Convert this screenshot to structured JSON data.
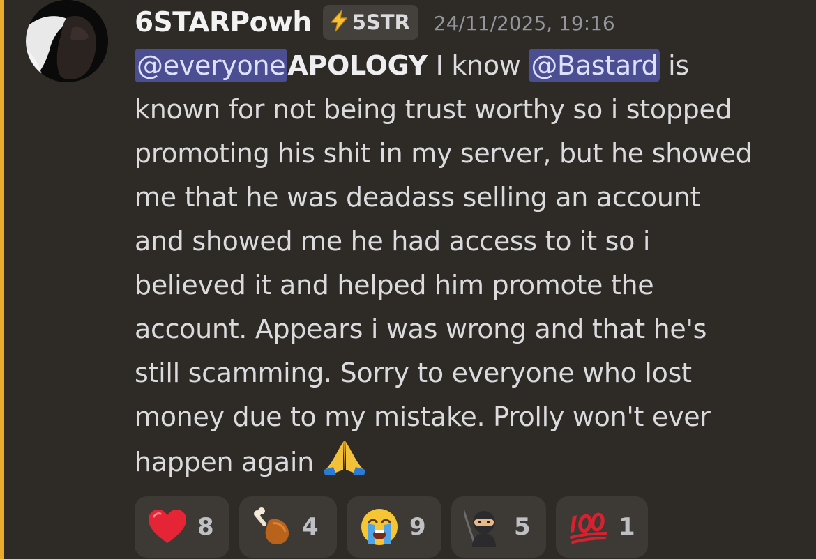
{
  "theme": {
    "background": "#2e2b27",
    "mention_highlight_bar": "#e8ab2e",
    "mention_pill": "#4b4f92",
    "text": "#dbdbde"
  },
  "message": {
    "author": {
      "username": "6STARPowh",
      "avatar_icon": "user-avatar",
      "tag": {
        "icon": "lightning-bolt-icon",
        "label": "5STR"
      }
    },
    "timestamp": "24/11/2025, 19:16",
    "body": {
      "mention_everyone": "@everyone",
      "heading": "APOLOGY",
      "text_1": " I know ",
      "mention_user": "@Bastard",
      "text_2": " is",
      "lines": [
        "known for not being trust worthy so i stopped",
        "promoting his shit in my server, but he showed",
        "me that he was deadass selling an account",
        "and showed me he had access to it so i",
        "believed it and helped him promote the",
        "account. Appears i was wrong and that he's",
        "still scamming. Sorry to everyone who lost",
        "money due to my mistake. Prolly won't ever"
      ],
      "last_line": "happen again ",
      "trailing_emoji": "folded-hands-emoji"
    },
    "reactions": [
      {
        "emoji": "red-heart-emoji",
        "count": "8"
      },
      {
        "emoji": "poultry-leg-emoji",
        "count": "4"
      },
      {
        "emoji": "loudly-crying-face-emoji",
        "count": "9"
      },
      {
        "emoji": "ninja-emoji",
        "count": "5"
      },
      {
        "emoji": "hundred-points-emoji",
        "count": "1"
      }
    ]
  }
}
